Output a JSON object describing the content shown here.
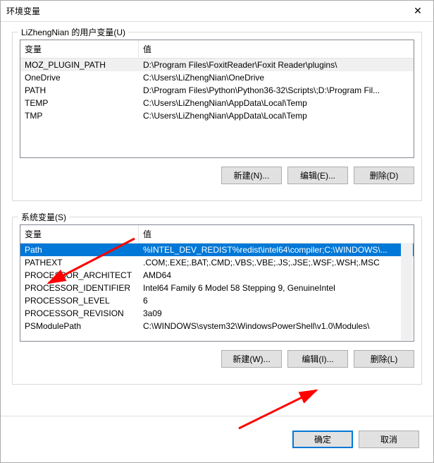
{
  "window": {
    "title": "环境变量"
  },
  "userGroup": {
    "label": "LiZhengNian 的用户变量(U)",
    "head_name": "变量",
    "head_value": "值",
    "rows": [
      {
        "name": "MOZ_PLUGIN_PATH",
        "value": "D:\\Program Files\\FoxitReader\\Foxit Reader\\plugins\\"
      },
      {
        "name": "OneDrive",
        "value": "C:\\Users\\LiZhengNian\\OneDrive"
      },
      {
        "name": "PATH",
        "value": "D:\\Program Files\\Python\\Python36-32\\Scripts\\;D:\\Program Fil..."
      },
      {
        "name": "TEMP",
        "value": "C:\\Users\\LiZhengNian\\AppData\\Local\\Temp"
      },
      {
        "name": "TMP",
        "value": "C:\\Users\\LiZhengNian\\AppData\\Local\\Temp"
      }
    ],
    "buttons": {
      "new": "新建(N)...",
      "edit": "编辑(E)...",
      "delete": "删除(D)"
    }
  },
  "systemGroup": {
    "label": "系统变量(S)",
    "head_name": "变量",
    "head_value": "值",
    "rows": [
      {
        "name": "Path",
        "value": "%INTEL_DEV_REDIST%redist\\intel64\\compiler;C:\\WINDOWS\\..."
      },
      {
        "name": "PATHEXT",
        "value": ".COM;.EXE;.BAT;.CMD;.VBS;.VBE;.JS;.JSE;.WSF;.WSH;.MSC"
      },
      {
        "name": "PROCESSOR_ARCHITECT",
        "value": "AMD64"
      },
      {
        "name": "PROCESSOR_IDENTIFIER",
        "value": "Intel64 Family 6 Model 58 Stepping 9, GenuineIntel"
      },
      {
        "name": "PROCESSOR_LEVEL",
        "value": "6"
      },
      {
        "name": "PROCESSOR_REVISION",
        "value": "3a09"
      },
      {
        "name": "PSModulePath",
        "value": "C:\\WINDOWS\\system32\\WindowsPowerShell\\v1.0\\Modules\\"
      }
    ],
    "selectedIndex": 0,
    "buttons": {
      "new": "新建(W)...",
      "edit": "编辑(I)...",
      "delete": "删除(L)"
    }
  },
  "footer": {
    "ok": "确定",
    "cancel": "取消"
  },
  "annotations": {
    "arrow_color": "#ff0000"
  }
}
